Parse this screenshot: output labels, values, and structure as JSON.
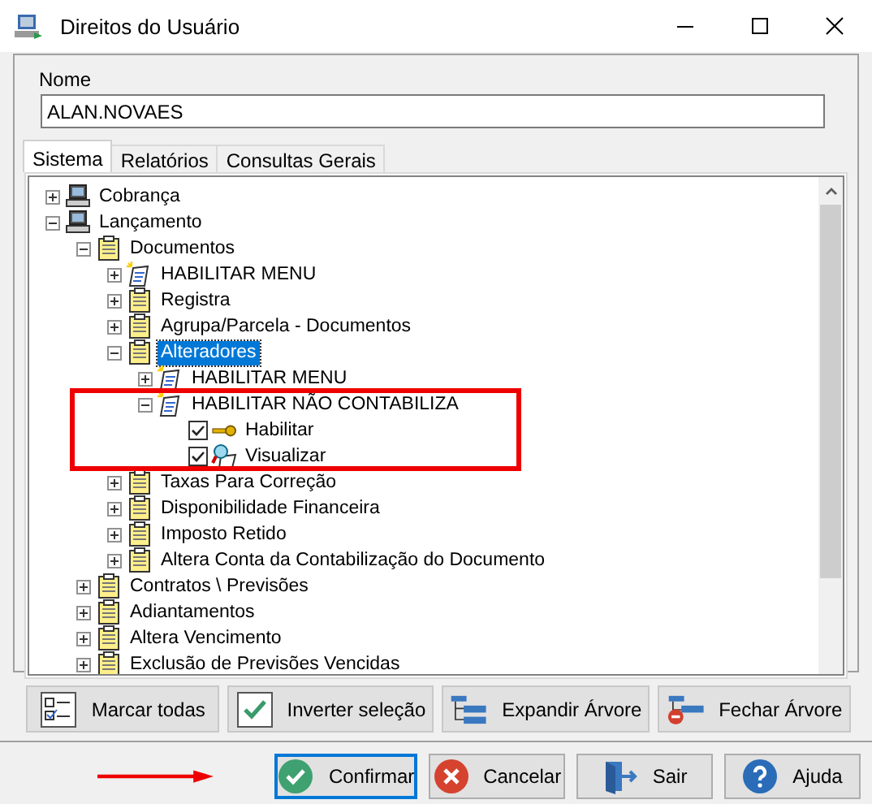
{
  "window": {
    "title": "Direitos do Usuário"
  },
  "name_field": {
    "label": "Nome",
    "value": "ALAN.NOVAES"
  },
  "tabs": [
    {
      "label": "Sistema",
      "selected": true
    },
    {
      "label": "Relatórios",
      "selected": false
    },
    {
      "label": "Consultas Gerais",
      "selected": false
    }
  ],
  "tree": [
    {
      "label": "Cobrança",
      "kind": "computer",
      "expanded": false,
      "selected": false
    },
    {
      "label": "Lançamento",
      "kind": "computer",
      "expanded": true,
      "selected": false,
      "children": [
        {
          "label": "Documentos",
          "kind": "doc",
          "expanded": true,
          "selected": false,
          "children": [
            {
              "label": "HABILITAR MENU",
              "kind": "menu",
              "expanded": false,
              "selected": false
            },
            {
              "label": "Registra",
              "kind": "doc",
              "expanded": false,
              "selected": false
            },
            {
              "label": "Agrupa/Parcela - Documentos",
              "kind": "doc",
              "expanded": false,
              "selected": false
            },
            {
              "label": "Alteradores",
              "kind": "doc",
              "expanded": true,
              "selected": true,
              "children": [
                {
                  "label": "HABILITAR MENU",
                  "kind": "menu",
                  "expanded": false,
                  "selected": false
                },
                {
                  "label": "HABILITAR NÃO CONTABILIZA",
                  "kind": "menu",
                  "expanded": true,
                  "selected": false,
                  "highlighted": true,
                  "children": [
                    {
                      "label": "Habilitar",
                      "kind": "key",
                      "checked": true,
                      "selected": false
                    },
                    {
                      "label": "Visualizar",
                      "kind": "view",
                      "checked": true,
                      "selected": false
                    }
                  ]
                }
              ]
            },
            {
              "label": "Taxas Para Correção",
              "kind": "doc",
              "expanded": false,
              "selected": false
            },
            {
              "label": "Disponibilidade Financeira",
              "kind": "doc",
              "expanded": false,
              "selected": false
            },
            {
              "label": "Imposto Retido",
              "kind": "doc",
              "expanded": false,
              "selected": false
            },
            {
              "label": "Altera Conta da Contabilização do Documento",
              "kind": "doc",
              "expanded": false,
              "selected": false
            }
          ]
        },
        {
          "label": "Contratos \\ Previsões",
          "kind": "doc",
          "expanded": false,
          "selected": false
        },
        {
          "label": "Adiantamentos",
          "kind": "doc",
          "expanded": false,
          "selected": false
        },
        {
          "label": "Altera Vencimento",
          "kind": "doc",
          "expanded": false,
          "selected": false
        },
        {
          "label": "Exclusão de Previsões Vencidas",
          "kind": "doc",
          "expanded": false,
          "selected": false
        }
      ]
    }
  ],
  "tree_buttons": [
    {
      "label": "Marcar todas",
      "kind": "mark-all"
    },
    {
      "label": "Inverter seleção",
      "kind": "invert"
    },
    {
      "label": "Expandir Árvore",
      "kind": "expand"
    },
    {
      "label": "Fechar Árvore",
      "kind": "collapse"
    }
  ],
  "footer": {
    "arrow_annotation": true,
    "buttons": [
      {
        "label": "Confirmar",
        "kind": "confirm",
        "focused": true
      },
      {
        "label": "Cancelar",
        "kind": "cancel",
        "focused": false
      },
      {
        "label": "Sair",
        "kind": "exit",
        "focused": false
      },
      {
        "label": "Ajuda",
        "kind": "help",
        "focused": false
      }
    ]
  }
}
